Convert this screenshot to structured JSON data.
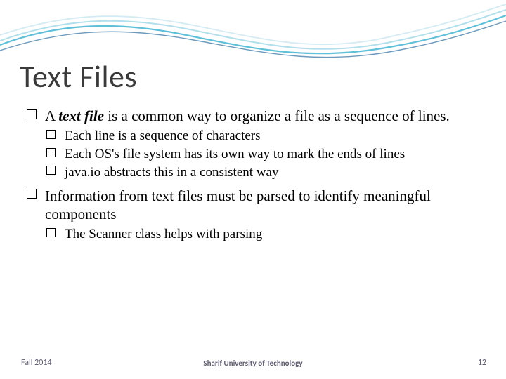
{
  "slide": {
    "title": "Text Files",
    "bullets": {
      "b1_pre": "A ",
      "b1_em": "text file",
      "b1_post": " is a common way to organize a file as a sequence of lines.",
      "b1a": "Each line is a sequence of characters",
      "b1b": "Each OS's file system has its own way to mark the ends of lines",
      "b1c": "java.io abstracts this in a consistent way",
      "b2": "Information from text files must be parsed to identify meaningful components",
      "b2a": "The Scanner class helps with parsing"
    }
  },
  "footer": {
    "left": "Fall 2014",
    "center": "Sharif University of Technology",
    "page": "12"
  }
}
